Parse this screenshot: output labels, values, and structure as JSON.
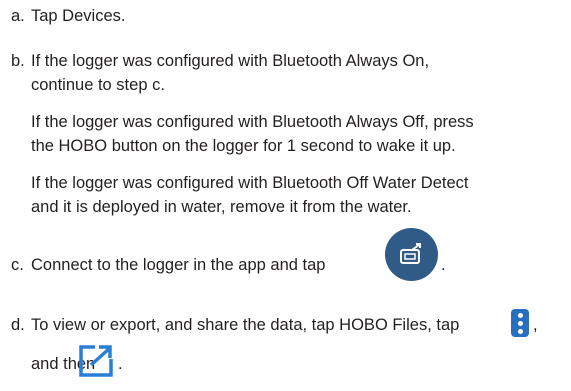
{
  "steps": [
    {
      "label": "a.",
      "text": "Tap Devices."
    },
    {
      "label": "b.",
      "lines": [
        "If the logger was configured with Bluetooth Always On,",
        "continue to step c."
      ]
    },
    {
      "label": "c.",
      "text": "Connect to the logger in the app and tap"
    },
    {
      "label": "d.",
      "text": "To view or export, and share the data, tap HOBO Files, tap",
      "text2": "and then"
    }
  ],
  "paragraphs": [
    [
      "If the logger was configured with Bluetooth Always Off, press",
      "the HOBO button on the logger for 1 second to wake it up."
    ],
    [
      "If the logger was configured with Bluetooth Off Water Detect",
      "and it is deployed in water, remove it from the water."
    ]
  ],
  "punct": {
    "comma": ",",
    "period": "."
  },
  "icons": {
    "readout": "readout-icon",
    "more": "more-vertical-icon",
    "export": "export-icon"
  },
  "colors": {
    "readout_bg": "#2f5b86",
    "more_bg": "#2a6fbf",
    "export_stroke": "#2a7fd4"
  }
}
